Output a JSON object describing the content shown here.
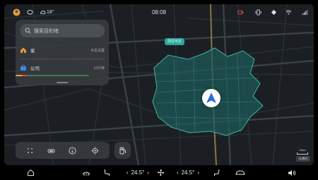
{
  "status_bar": {
    "temperature": "18°",
    "time": "08:08"
  },
  "search_card": {
    "placeholder": "搜索目的地",
    "home": {
      "label": "家",
      "meta": "点击设置"
    },
    "work": {
      "label": "公司",
      "meta": "12分钟"
    }
  },
  "map": {
    "pin_label": "前往可达",
    "scale_label": "10km",
    "mode_label": "3D模式"
  },
  "dock": {
    "driver_temp": "24.5°",
    "passenger_temp": "24.5°",
    "left_chevron": "‹",
    "right_chevron": "›"
  },
  "colors": {
    "map_bg": "#1b1f23",
    "coverage_fill": "#1d5a58",
    "coverage_stroke": "#3fb3a8",
    "accent_blue": "#2a6fdb",
    "pin_teal": "#2aa79a",
    "home_orange": "#e8923a",
    "work_blue": "#3c86e0"
  }
}
